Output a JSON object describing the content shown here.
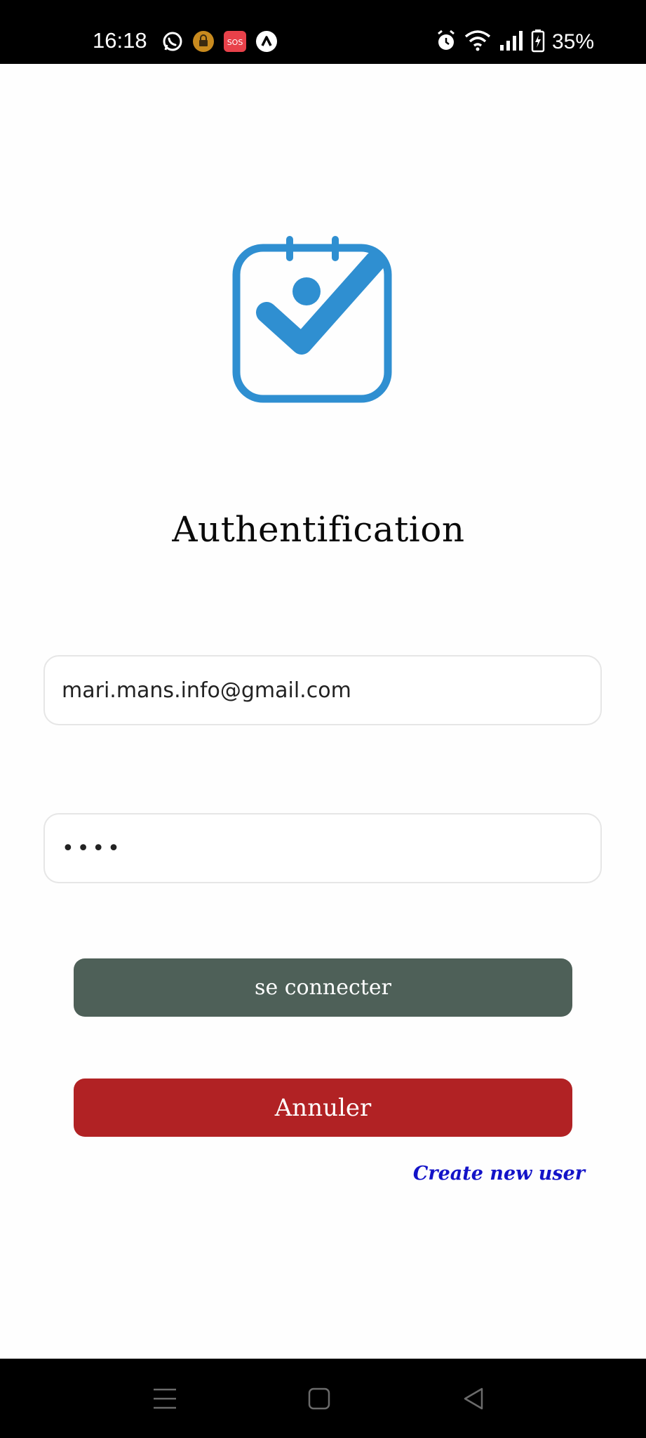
{
  "status_bar": {
    "time": "16:18",
    "battery_percent": "35%",
    "left_icons": [
      "whatsapp-icon",
      "lock-app-icon",
      "sos-icon",
      "arrow-app-icon"
    ],
    "right_icons": [
      "alarm-icon",
      "wifi-icon",
      "signal-icon",
      "battery-icon"
    ],
    "sos_label": "SOS"
  },
  "logo": {
    "icon": "calendar-check-icon",
    "color": "#2f8fd1"
  },
  "page": {
    "title": "Authentification"
  },
  "form": {
    "email_value": "mari.mans.info@gmail.com",
    "password_value": "••••",
    "connect_label": "se connecter",
    "cancel_label": "Annuler",
    "create_user_label": "Create new user"
  },
  "colors": {
    "connect_button": "#4e6058",
    "cancel_button": "#b12224",
    "link": "#1313c8"
  },
  "nav_bar": {
    "icons": [
      "recent-apps-icon",
      "home-icon",
      "back-icon"
    ]
  }
}
